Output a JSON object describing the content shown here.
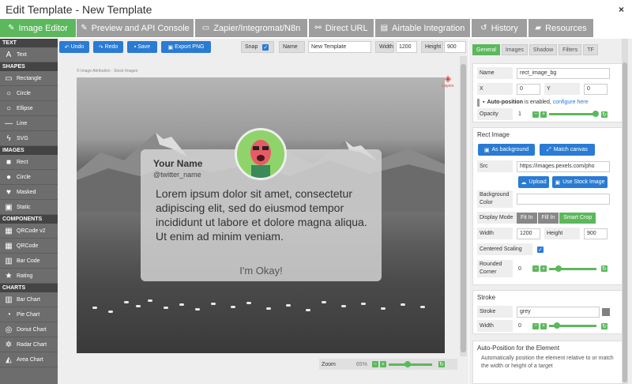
{
  "window": {
    "title": "Edit Template - New Template",
    "close": "×"
  },
  "tabs": [
    {
      "label": "Image Editor",
      "icon": "✎"
    },
    {
      "label": "Preview and API Console",
      "icon": "✎"
    },
    {
      "label": "Zapier/Integromat/N8n",
      "icon": "▭"
    },
    {
      "label": "Direct URL",
      "icon": "⚯"
    },
    {
      "label": "Airtable Integration",
      "icon": "▤"
    },
    {
      "label": "History",
      "icon": "↺"
    },
    {
      "label": "Resources",
      "icon": "▰"
    }
  ],
  "sidebar": {
    "sections": {
      "text": "TEXT",
      "shapes": "SHAPES",
      "images": "IMAGES",
      "components": "COMPONENTS",
      "charts": "CHARTS"
    },
    "items": {
      "text": "Text",
      "rectangle": "Rectangle",
      "circle": "Circle",
      "ellipse": "Ellipse",
      "line": "Line",
      "svg": "SVG",
      "rect": "Rect",
      "img_circle": "Circle",
      "masked": "Masked",
      "static": "Static",
      "qr2": "QRCode v2",
      "qr": "QRCode",
      "barcode": "Bar Code",
      "rating": "Rating",
      "bar": "Bar Chart",
      "pie": "Pie Chart",
      "donut": "Donut Chart",
      "radar": "Radar Chart",
      "area": "Area Chart"
    }
  },
  "toolbar": {
    "undo": "Undo",
    "redo": "Redo",
    "save": "Save",
    "export": "Export PNG",
    "snap_label": "Snap",
    "snap_checked": true,
    "name_label": "Name",
    "name_value": "New Template",
    "width_label": "Width",
    "width_value": "1200",
    "height_label": "Height",
    "height_value": "900"
  },
  "canvas": {
    "attribution": "© Image Attribution · Stock Images",
    "layers_label": "Layers",
    "card_name": "Your Name",
    "card_handle": "@twitter_name",
    "card_text": "Lorem ipsum dolor sit amet, consectetur adipiscing elit, sed do eiusmod tempor incididunt ut labore et dolore magna aliqua. Ut enim ad minim veniam.",
    "card_button": "I'm Okay!"
  },
  "zoom": {
    "label": "Zoom",
    "value": "65%"
  },
  "right_tabs": [
    "General",
    "Images",
    "Shadow",
    "Filters",
    "TF"
  ],
  "general": {
    "name_label": "Name",
    "name_value": "rect_image_bg",
    "x_label": "X",
    "x_value": "0",
    "y_label": "Y",
    "y_value": "0",
    "autopos_prefix": "Auto-position",
    "autopos_text": " is enabled, ",
    "autopos_link": "configure here",
    "opacity_label": "Opacity",
    "opacity_value": "1"
  },
  "rect_image": {
    "title": "Rect Image",
    "as_background": "As background",
    "match_canvas": "Match canvas",
    "src_label": "Src",
    "src_value": "https://images.pexels.com/pho",
    "upload": "Upload",
    "stock": "Use Stock Image",
    "bg_label": "Background Color",
    "display_label": "Display Mode",
    "modes": [
      "Fit In",
      "Fill In",
      "Smart Crop"
    ],
    "width_label": "Width",
    "width_value": "1200",
    "height_label": "Height",
    "height_value": "900",
    "centered_label": "Centered Scaling",
    "rounded_label": "Rounded Corner",
    "rounded_value": "0"
  },
  "stroke": {
    "title": "Stroke",
    "stroke_label": "Stroke",
    "stroke_value": "grey",
    "width_label": "Width",
    "width_value": "0"
  },
  "autopos": {
    "title": "Auto-Position for the Element",
    "desc": "Automatically position the element relative to or match the width or height of a target"
  }
}
